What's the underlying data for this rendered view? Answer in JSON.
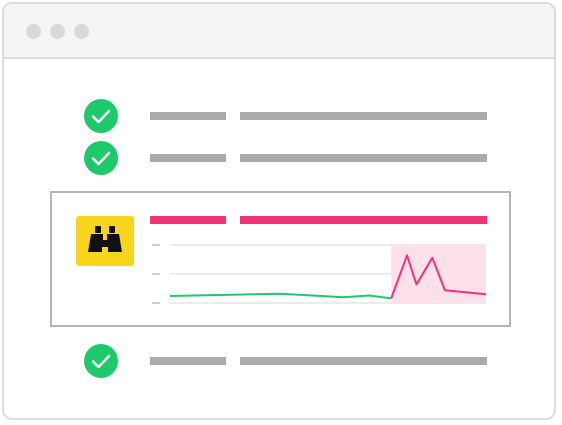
{
  "window": {
    "title_dots": [
      "close",
      "minimize",
      "maximize"
    ]
  },
  "rows": [
    {
      "status": "ok",
      "icon": "check-circle-icon"
    },
    {
      "status": "ok",
      "icon": "check-circle-icon"
    },
    {
      "status": "alert",
      "icon": "binoculars-icon"
    },
    {
      "status": "ok",
      "icon": "check-circle-icon"
    }
  ],
  "colors": {
    "ok_green": "#1ec96a",
    "alert_pink": "#f23378",
    "anomaly_fill": "#fde0ea",
    "icon_yellow": "#f7d51d",
    "placeholder_gray": "#aaaaaa",
    "line_green": "#1ec96a"
  },
  "chart_data": {
    "type": "line",
    "title": "",
    "xlabel": "",
    "ylabel": "",
    "grid": true,
    "xlim": [
      0,
      10
    ],
    "ylim": [
      0,
      10
    ],
    "series": [
      {
        "segment": "normal",
        "color": "#1ec96a",
        "points": [
          [
            0,
            1.2
          ],
          [
            3.5,
            1.6
          ],
          [
            5.5,
            1.0
          ],
          [
            6.3,
            1.3
          ],
          [
            7.0,
            0.8
          ]
        ]
      },
      {
        "segment": "anomaly",
        "color": "#f23378",
        "points": [
          [
            7.0,
            0.8
          ],
          [
            7.5,
            8.2
          ],
          [
            7.8,
            3.2
          ],
          [
            8.3,
            7.8
          ],
          [
            8.7,
            2.2
          ],
          [
            10.0,
            1.5
          ]
        ]
      }
    ],
    "highlight_region": {
      "x": [
        7.0,
        10.0
      ],
      "color": "#fde0ea"
    }
  }
}
